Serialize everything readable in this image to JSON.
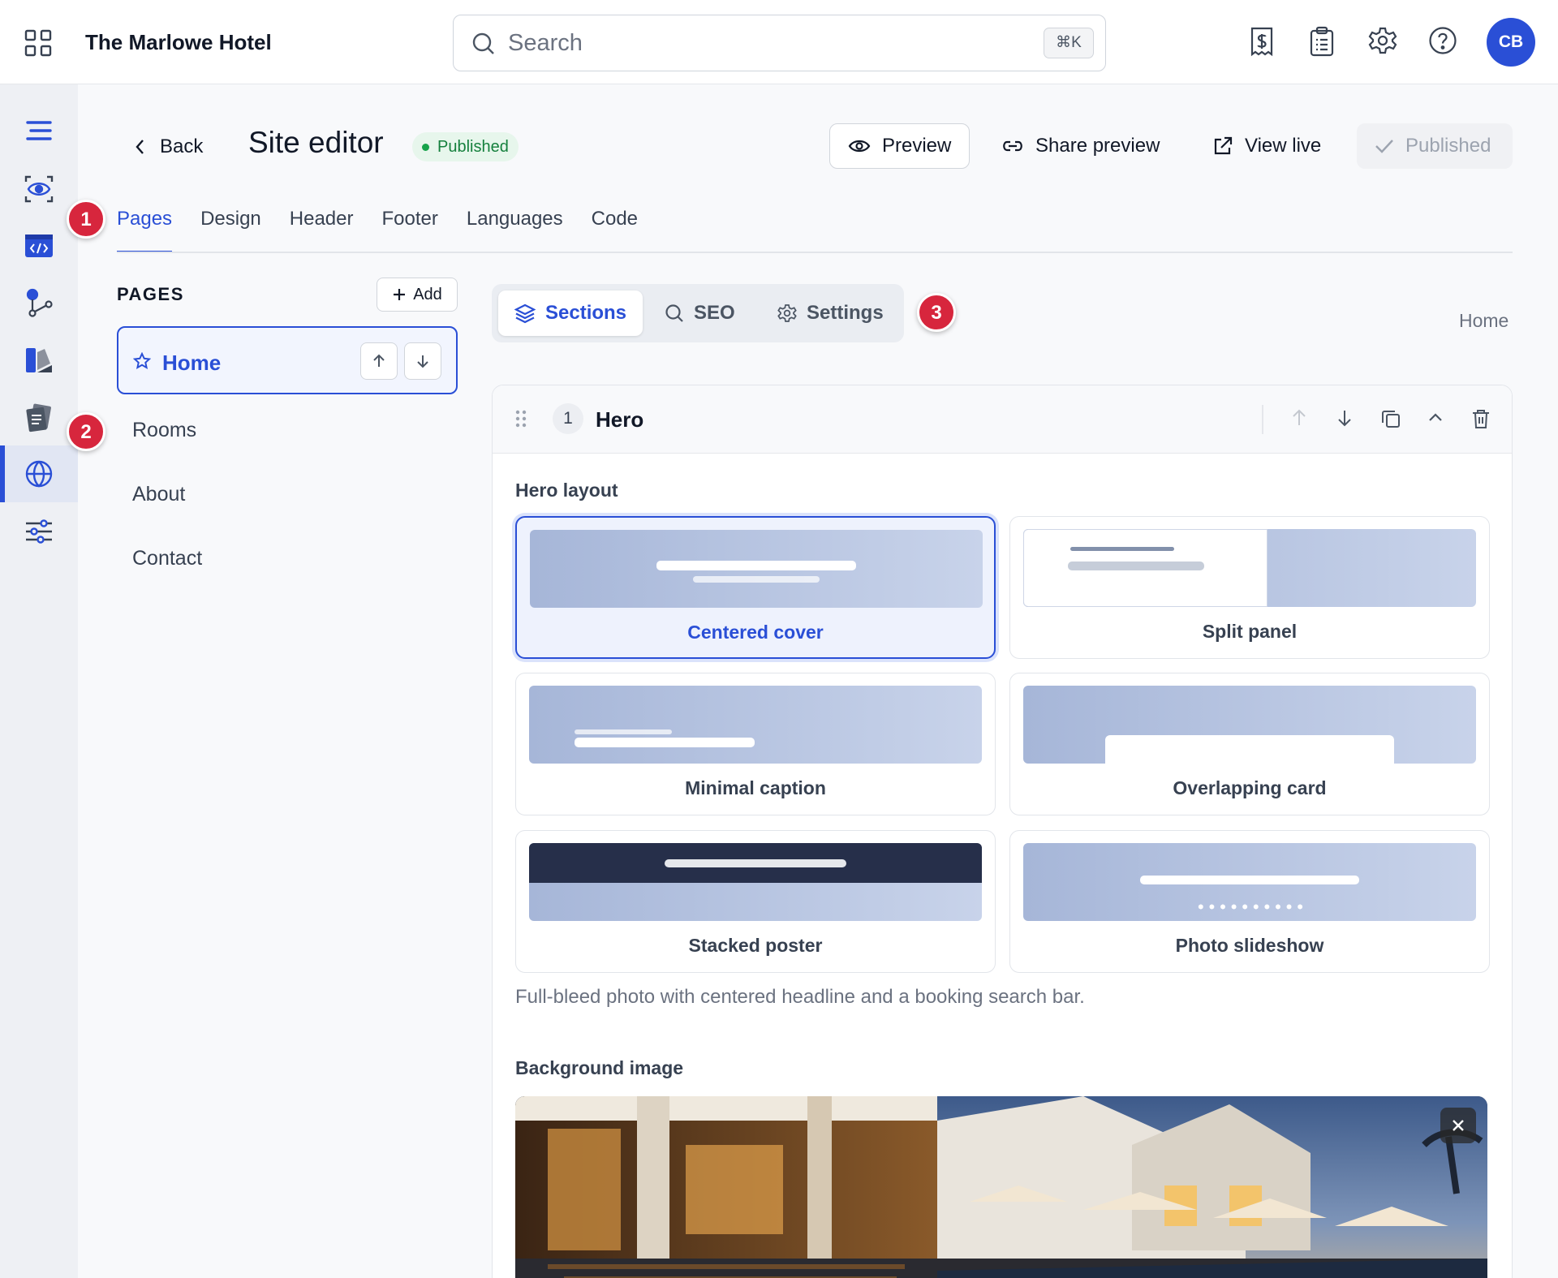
{
  "app": {
    "hotel_name": "The Marlowe Hotel",
    "avatar_initials": "CB"
  },
  "search": {
    "placeholder": "Search",
    "shortcut": "⌘K"
  },
  "topbar_icons": [
    "invoice-icon",
    "clipboard-icon",
    "gear-icon",
    "help-icon"
  ],
  "rail": {
    "items": [
      "menu-icon",
      "eye-icon",
      "code-window-icon",
      "workflow-icon",
      "palette-icon",
      "notes-icon",
      "globe-icon",
      "sliders-icon"
    ],
    "active": "globe-icon"
  },
  "header": {
    "back_label": "Back",
    "title": "Site editor",
    "status": "Published",
    "preview_label": "Preview",
    "share_label": "Share preview",
    "view_live_label": "View live",
    "published_button_label": "Published"
  },
  "tabs": [
    {
      "label": "Pages",
      "active": true
    },
    {
      "label": "Design"
    },
    {
      "label": "Header"
    },
    {
      "label": "Footer"
    },
    {
      "label": "Languages"
    },
    {
      "label": "Code"
    }
  ],
  "badges": [
    "1",
    "2",
    "3"
  ],
  "pages_panel": {
    "heading": "PAGES",
    "add_label": "Add",
    "pages": [
      "Home",
      "Rooms",
      "About",
      "Contact"
    ],
    "selected": "Home"
  },
  "subtabs": [
    {
      "label": "Sections",
      "active": true
    },
    {
      "label": "SEO"
    },
    {
      "label": "Settings"
    }
  ],
  "breadcrumb": "Home",
  "section": {
    "number": "1",
    "name": "Hero",
    "hero_layout_label": "Hero layout",
    "layouts": [
      "Centered cover",
      "Split panel",
      "Minimal caption",
      "Overlapping card",
      "Stacked poster",
      "Photo slideshow"
    ],
    "selected_layout": "Centered cover",
    "description": "Full-bleed photo with centered headline and a booking search bar.",
    "background_label": "Background image"
  },
  "colors": {
    "accent": "#2a4fd6",
    "badge": "#d7263d",
    "published_green": "#15803d"
  }
}
